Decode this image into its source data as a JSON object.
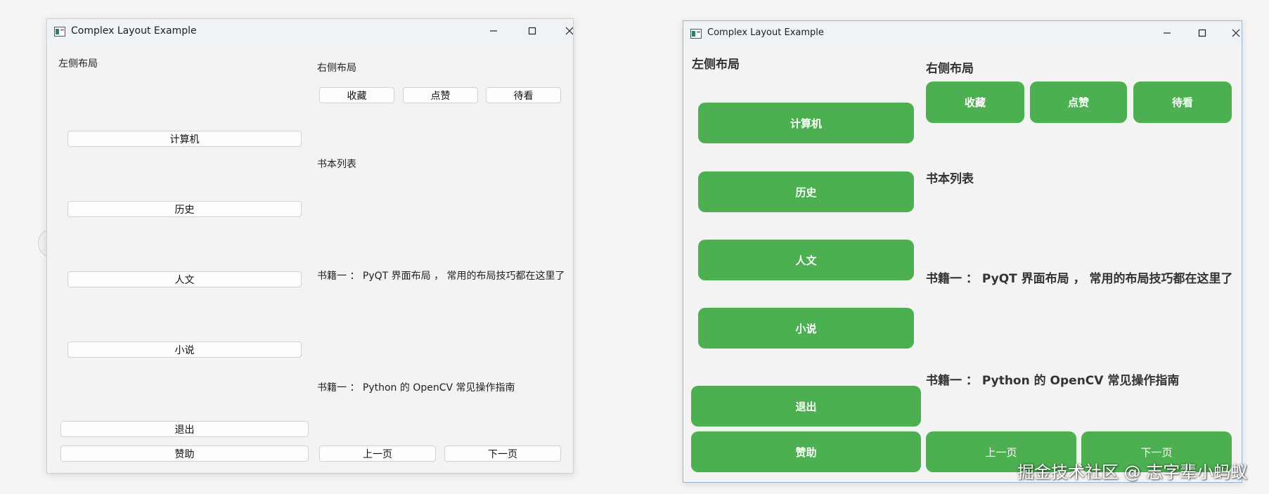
{
  "window_title": "Complex Layout Example",
  "left": {
    "heading": "左侧布局",
    "nav": [
      "计算机",
      "历史",
      "人文",
      "小说"
    ],
    "exit": "退出",
    "sponsor": "赞助"
  },
  "right": {
    "heading": "右侧布局",
    "actions": [
      "收藏",
      "点赞",
      "待看"
    ],
    "list_title": "书本列表",
    "books": [
      "书籍一 ： PyQT 界面布局 ， 常用的布局技巧都在这里了",
      "书籍一 ： Python 的 OpenCV 常见操作指南"
    ],
    "prev": "上一页",
    "next": "下一页"
  },
  "watermark": "掘金技术社区 @ 志字辈小蚂蚁",
  "colors": {
    "accent_green": "#4caf50",
    "window_bg": "#f3f3f3",
    "title_bg": "#eef3f6"
  },
  "icons": [
    "app-icon",
    "minimize-icon",
    "maximize-icon",
    "close-icon"
  ]
}
